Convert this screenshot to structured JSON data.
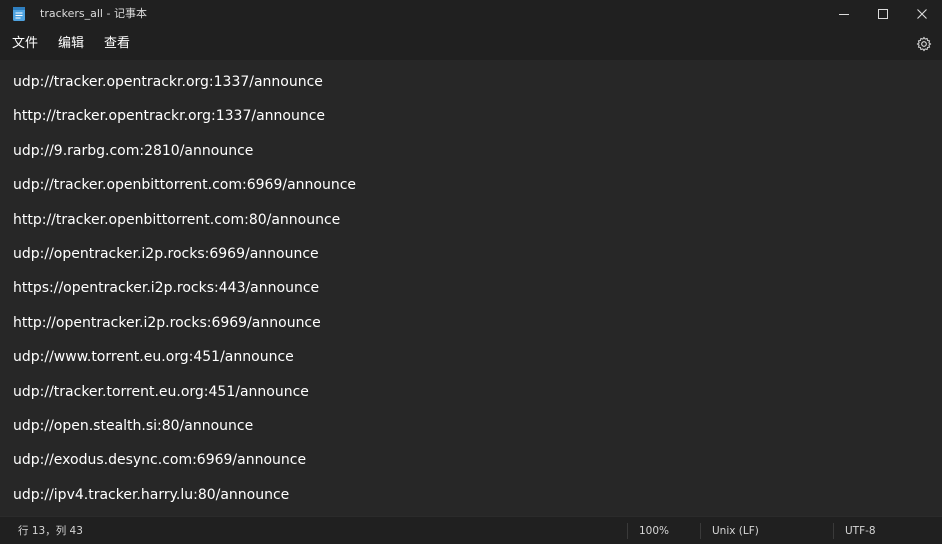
{
  "window": {
    "title": "trackers_all - 记事本",
    "icon": "notepad-icon"
  },
  "window_controls": {
    "minimize_icon": "minimize-icon",
    "maximize_icon": "maximize-icon",
    "close_icon": "close-icon"
  },
  "menu": {
    "items": [
      {
        "label": "文件"
      },
      {
        "label": "编辑"
      },
      {
        "label": "查看"
      }
    ],
    "settings_icon": "gear-icon"
  },
  "editor": {
    "lines": [
      "udp://tracker.opentrackr.org:1337/announce",
      "http://tracker.opentrackr.org:1337/announce",
      "udp://9.rarbg.com:2810/announce",
      "udp://tracker.openbittorrent.com:6969/announce",
      "http://tracker.openbittorrent.com:80/announce",
      "udp://opentracker.i2p.rocks:6969/announce",
      "https://opentracker.i2p.rocks:443/announce",
      "http://opentracker.i2p.rocks:6969/announce",
      "udp://www.torrent.eu.org:451/announce",
      "udp://tracker.torrent.eu.org:451/announce",
      "udp://open.stealth.si:80/announce",
      "udp://exodus.desync.com:6969/announce",
      "udp://ipv4.tracker.harry.lu:80/announce"
    ]
  },
  "status": {
    "position": "行 13，列 43",
    "zoom": "100%",
    "line_ending": "Unix (LF)",
    "encoding": "UTF-8"
  },
  "colors": {
    "titlebar": "#202020",
    "editor_bg": "#272727",
    "text": "#ffffff",
    "icon_accent": "#4fa3e0"
  }
}
